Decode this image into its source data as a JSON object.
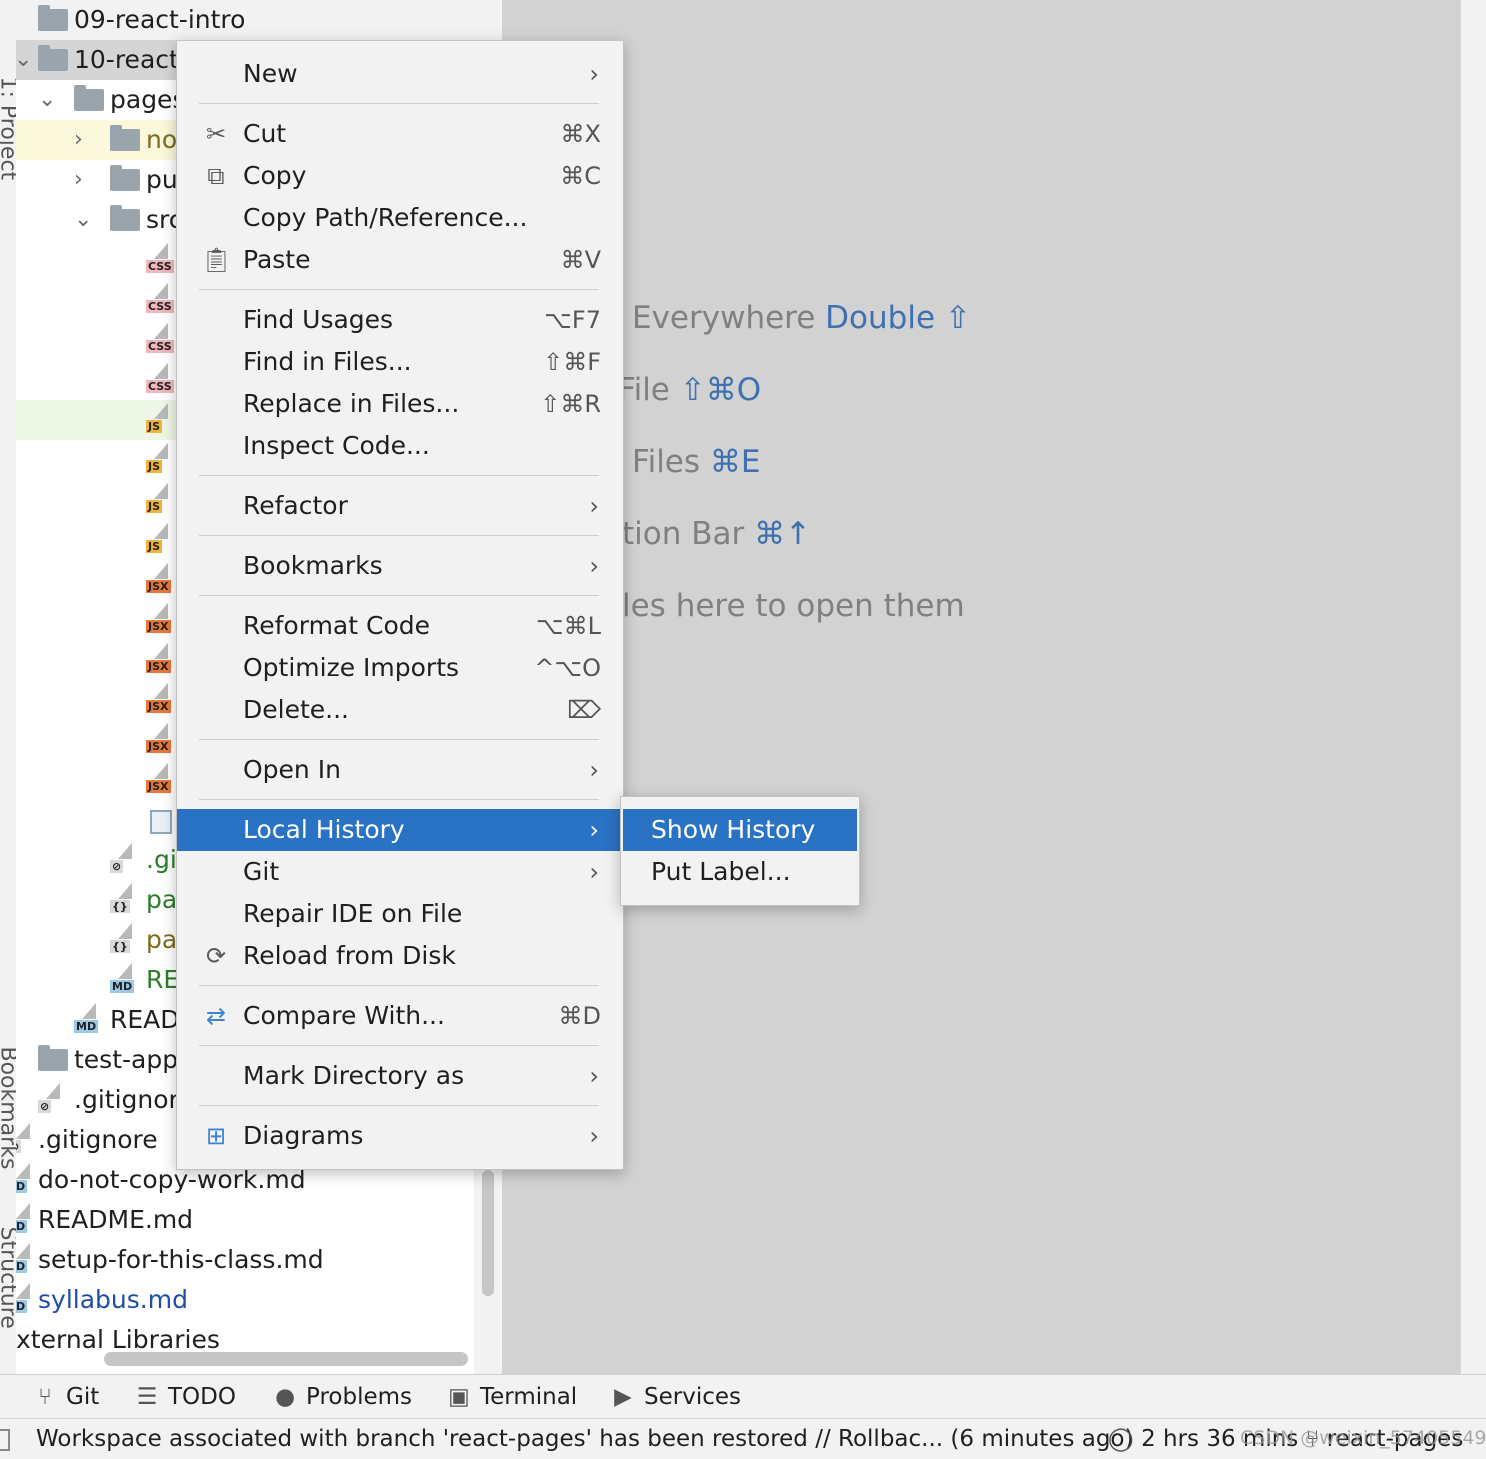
{
  "side_labels": {
    "project": "1: Project",
    "bookmarks": "Bookmarks",
    "structure": "Structure"
  },
  "tree": {
    "items": [
      {
        "label": "09-react-intro",
        "kind": "folder"
      },
      {
        "label": "10-react",
        "kind": "folder"
      },
      {
        "label": "pages",
        "kind": "folder"
      },
      {
        "label": "no",
        "kind": "folder"
      },
      {
        "label": "pu",
        "kind": "folder"
      },
      {
        "label": "src",
        "kind": "folder"
      },
      {
        "label": "CSS"
      },
      {
        "label": "CSS"
      },
      {
        "label": "CSS"
      },
      {
        "label": "CSS"
      },
      {
        "label": "JS"
      },
      {
        "label": "JS"
      },
      {
        "label": "JS"
      },
      {
        "label": "JS"
      },
      {
        "label": "JSX"
      },
      {
        "label": "JSX"
      },
      {
        "label": "JSX"
      },
      {
        "label": "JSX"
      },
      {
        "label": "JSX"
      },
      {
        "label": "JSX"
      },
      {
        "label": ".gi"
      },
      {
        "label": "pa"
      },
      {
        "label": "pa"
      },
      {
        "label": "RE"
      },
      {
        "label": "READ"
      },
      {
        "label": "test-app",
        "kind": "folder"
      },
      {
        "label": ".gitignore"
      },
      {
        "label": ".gitignore"
      },
      {
        "label": "do-not-copy-work.md"
      },
      {
        "label": "README.md"
      },
      {
        "label": "setup-for-this-class.md"
      },
      {
        "label": "syllabus.md"
      },
      {
        "label": "xternal Libraries"
      }
    ],
    "tags": {
      "css": "CSS",
      "js": "JS",
      "jsx": "JSX",
      "md": "MD",
      "d": "D"
    }
  },
  "editor_hints": [
    {
      "text": "Everywhere",
      "key": "Double ⇧"
    },
    {
      "text": "File",
      "key": "⇧⌘O"
    },
    {
      "text": "Files",
      "key": "⌘E"
    },
    {
      "text": "tion Bar",
      "key": "⌘↑"
    },
    {
      "text": "les here to open them",
      "key": ""
    }
  ],
  "menu": {
    "new": "New",
    "cut": "Cut",
    "cut_sc": "⌘X",
    "copy": "Copy",
    "copy_sc": "⌘C",
    "copy_path": "Copy Path/Reference...",
    "paste": "Paste",
    "paste_sc": "⌘V",
    "find_usages": "Find Usages",
    "find_usages_sc": "⌥F7",
    "find_in_files": "Find in Files...",
    "find_in_files_sc": "⇧⌘F",
    "replace_in_files": "Replace in Files...",
    "replace_in_files_sc": "⇧⌘R",
    "inspect_code": "Inspect Code...",
    "refactor": "Refactor",
    "bookmarks": "Bookmarks",
    "reformat_code": "Reformat Code",
    "reformat_code_sc": "⌥⌘L",
    "optimize_imports": "Optimize Imports",
    "optimize_imports_sc": "^⌥O",
    "delete": "Delete...",
    "delete_sc": "⌦",
    "open_in": "Open In",
    "local_history": "Local History",
    "git": "Git",
    "repair_ide": "Repair IDE on File",
    "reload_from_disk": "Reload from Disk",
    "compare_with": "Compare With...",
    "compare_with_sc": "⌘D",
    "mark_directory": "Mark Directory as",
    "diagrams": "Diagrams"
  },
  "submenu": {
    "show_history": "Show History",
    "put_label": "Put Label..."
  },
  "toolwindows": {
    "git": "Git",
    "todo": "TODO",
    "problems": "Problems",
    "terminal": "Terminal",
    "services": "Services"
  },
  "status": {
    "message": "Workspace associated with branch 'react-pages' has been restored // Rollbac... (6 minutes ago)",
    "time": "2 hrs 36 mins",
    "branch": "react-pages",
    "watermark": "CSDN @weixin_57405549"
  },
  "colors": {
    "selection": "#2a72c3",
    "editor_bg": "#d2d2d2",
    "hint_key": "#3f71b0"
  }
}
